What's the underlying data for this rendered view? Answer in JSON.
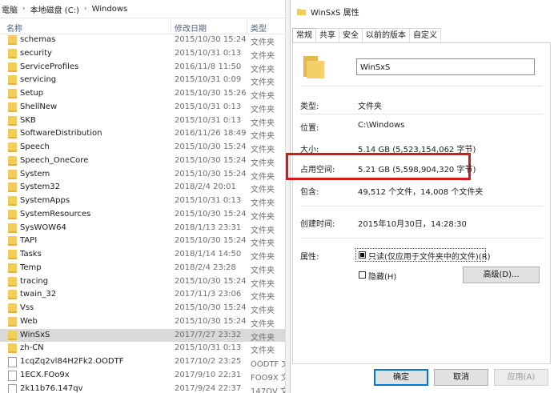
{
  "explorer": {
    "breadcrumb": [
      "電脑",
      "本地磁盘 (C:)",
      "Windows"
    ],
    "columns": {
      "name": "名称",
      "date": "修改日期",
      "type": "类型"
    },
    "rows": [
      {
        "name": "schemas",
        "date": "2015/10/30 15:24",
        "type": "文件夹",
        "kind": "folder"
      },
      {
        "name": "security",
        "date": "2015/10/31 0:13",
        "type": "文件夹",
        "kind": "folder"
      },
      {
        "name": "ServiceProfiles",
        "date": "2016/11/8 11:50",
        "type": "文件夹",
        "kind": "folder"
      },
      {
        "name": "servicing",
        "date": "2015/10/31 0:09",
        "type": "文件夹",
        "kind": "folder"
      },
      {
        "name": "Setup",
        "date": "2015/10/30 15:26",
        "type": "文件夹",
        "kind": "folder"
      },
      {
        "name": "ShellNew",
        "date": "2015/10/31 0:13",
        "type": "文件夹",
        "kind": "folder"
      },
      {
        "name": "SKB",
        "date": "2015/10/31 0:13",
        "type": "文件夹",
        "kind": "folder"
      },
      {
        "name": "SoftwareDistribution",
        "date": "2016/11/26 18:49",
        "type": "文件夹",
        "kind": "folder"
      },
      {
        "name": "Speech",
        "date": "2015/10/30 15:24",
        "type": "文件夹",
        "kind": "folder"
      },
      {
        "name": "Speech_OneCore",
        "date": "2015/10/30 15:24",
        "type": "文件夹",
        "kind": "folder"
      },
      {
        "name": "System",
        "date": "2015/10/30 15:24",
        "type": "文件夹",
        "kind": "folder"
      },
      {
        "name": "System32",
        "date": "2018/2/4 20:01",
        "type": "文件夹",
        "kind": "folder"
      },
      {
        "name": "SystemApps",
        "date": "2015/10/31 0:13",
        "type": "文件夹",
        "kind": "folder"
      },
      {
        "name": "SystemResources",
        "date": "2015/10/30 15:24",
        "type": "文件夹",
        "kind": "folder"
      },
      {
        "name": "SysWOW64",
        "date": "2018/1/13 23:31",
        "type": "文件夹",
        "kind": "folder"
      },
      {
        "name": "TAPI",
        "date": "2015/10/30 15:24",
        "type": "文件夹",
        "kind": "folder"
      },
      {
        "name": "Tasks",
        "date": "2018/1/14 14:50",
        "type": "文件夹",
        "kind": "folder"
      },
      {
        "name": "Temp",
        "date": "2018/2/4 23:28",
        "type": "文件夹",
        "kind": "folder"
      },
      {
        "name": "tracing",
        "date": "2015/10/30 15:24",
        "type": "文件夹",
        "kind": "folder"
      },
      {
        "name": "twain_32",
        "date": "2017/11/3 23:06",
        "type": "文件夹",
        "kind": "folder"
      },
      {
        "name": "Vss",
        "date": "2015/10/30 15:24",
        "type": "文件夹",
        "kind": "folder"
      },
      {
        "name": "Web",
        "date": "2015/10/30 15:24",
        "type": "文件夹",
        "kind": "folder"
      },
      {
        "name": "WinSxS",
        "date": "2017/7/27 23:32",
        "type": "文件夹",
        "kind": "folder",
        "selected": true
      },
      {
        "name": "zh-CN",
        "date": "2015/10/31 0:13",
        "type": "文件夹",
        "kind": "folder"
      },
      {
        "name": "1cqZq2vl84H2Fk2.OODTF",
        "date": "2017/10/2 23:25",
        "type": "OODTF 文",
        "kind": "file"
      },
      {
        "name": "1ECX.FOo9x",
        "date": "2017/9/10 22:31",
        "type": "FOO9X 文",
        "kind": "file"
      },
      {
        "name": "2k11b76.147qv",
        "date": "2017/9/24 22:37",
        "type": "147QV 文",
        "kind": "file"
      }
    ]
  },
  "dialog": {
    "title": "WinSxS 属性",
    "tabs": [
      "常规",
      "共享",
      "安全",
      "以前的版本",
      "自定义"
    ],
    "active_tab": "常规",
    "folder_name": "WinSxS",
    "props": {
      "type_label": "类型:",
      "type_value": "文件夹",
      "location_label": "位置:",
      "location_value": "C:\\Windows",
      "size_label": "大小:",
      "size_value": "5.14 GB (5,523,154,062 字节)",
      "disk_label": "占用空间:",
      "disk_value": "5.21 GB (5,598,904,320 字节)",
      "contains_label": "包含:",
      "contains_value": "49,512 个文件，14,008 个文件夹",
      "created_label": "创建时间:",
      "created_value": "2015年10月30日，14:28:30",
      "attributes_label": "属性:",
      "readonly_label": "只读(仅应用于文件夹中的文件)(R)",
      "hidden_label": "隐藏(H)",
      "advanced_label": "高级(D)..."
    },
    "buttons": {
      "ok": "确定",
      "cancel": "取消",
      "apply": "应用(A)"
    }
  }
}
